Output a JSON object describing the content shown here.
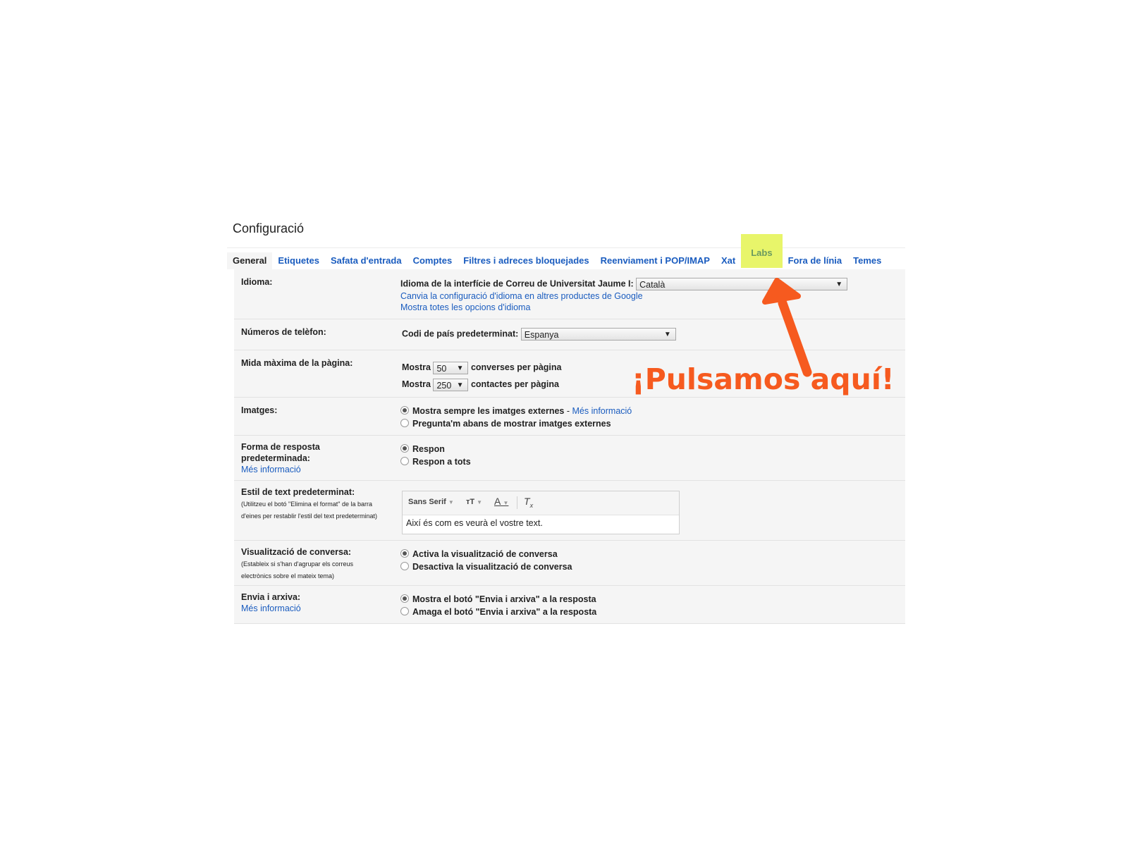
{
  "title": "Configuració",
  "tabs": [
    {
      "label": "General",
      "active": true
    },
    {
      "label": "Etiquetes"
    },
    {
      "label": "Safata d'entrada"
    },
    {
      "label": "Comptes"
    },
    {
      "label": "Filtres i adreces bloquejades"
    },
    {
      "label": "Reenviament i POP/IMAP"
    },
    {
      "label": "Xat"
    },
    {
      "label": "Labs",
      "highlighted": true
    },
    {
      "label": "Fora de línia"
    },
    {
      "label": "Temes"
    }
  ],
  "language": {
    "label": "Idioma:",
    "interface_label": "Idioma de la interfície de Correu de Universitat Jaume I:",
    "selected": "Català",
    "link1": "Canvia la configuració d'idioma en altres productes de Google",
    "link2": "Mostra totes les opcions d'idioma"
  },
  "phone": {
    "label": "Números de telèfon:",
    "country_label": "Codi de país predeterminat:",
    "selected": "Espanya"
  },
  "page_size": {
    "label": "Mida màxima de la pàgina:",
    "show": "Mostra",
    "conversations_value": "50",
    "conversations_suffix": "converses per pàgina",
    "contacts_value": "250",
    "contacts_suffix": "contactes per pàgina"
  },
  "images": {
    "label": "Imatges:",
    "opt1": "Mostra sempre les imatges externes",
    "opt1_sep": " - ",
    "opt1_link": "Més informació",
    "opt2": "Pregunta'm abans de mostrar imatges externes"
  },
  "reply": {
    "label": "Forma de resposta predeterminada:",
    "link": "Més informació",
    "opt1": "Respon",
    "opt2": "Respon a tots"
  },
  "text_style": {
    "label": "Estil de text predeterminat:",
    "note": "(Utilitzeu el botó \"Elimina el format\" de la barra d'eines per restablir l'estil del text predeterminat)",
    "font": "Sans Serif",
    "size_icon": "text-size-icon",
    "color_icon": "text-color-icon",
    "clear_icon": "remove-format-icon",
    "preview": "Així és com es veurà el vostre text."
  },
  "conversation": {
    "label": "Visualització de conversa:",
    "note": "(Estableix si s'han d'agrupar els correus electrònics sobre el mateix tema)",
    "opt1": "Activa la visualització de conversa",
    "opt2": "Desactiva la visualització de conversa"
  },
  "send_archive": {
    "label": "Envia i arxiva:",
    "link": "Més informació",
    "opt1": "Mostra el botó \"Envia i arxiva\" a la resposta",
    "opt2": "Amaga el botó \"Envia i arxiva\" a la resposta"
  },
  "annotation": {
    "text": "¡Pulsamos aquí!",
    "color": "#f65a1f",
    "highlight_color": "#e8f56a"
  }
}
